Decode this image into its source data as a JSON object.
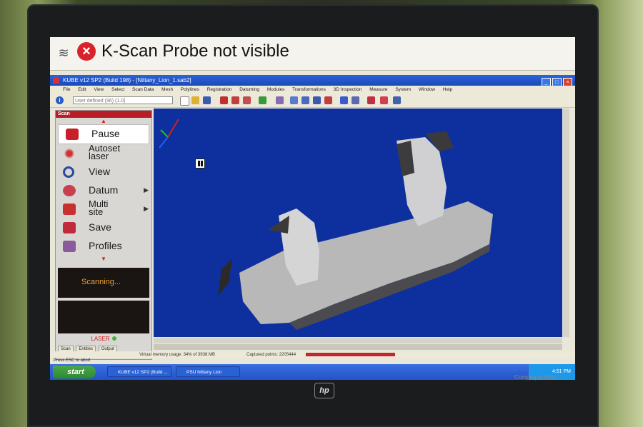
{
  "status_bar": {
    "message": "K-Scan Probe not visible"
  },
  "window": {
    "title": "KUBE v12 SP2 (Build 198) - [Nittany_Lion_1.sab2]",
    "menu": [
      "File",
      "Edit",
      "View",
      "Select",
      "Scan Data",
      "Mesh",
      "Polylines",
      "Registration",
      "Datuming",
      "Modules",
      "Transformations",
      "3D Inspection",
      "Measure",
      "System",
      "Window",
      "Help"
    ],
    "coord_system": "User defined (96) (1.0)"
  },
  "scan_panel": {
    "header": "Scan",
    "items": [
      {
        "label": "Pause",
        "icon": "pause-icon",
        "submenu": false
      },
      {
        "label": "Autoset laser",
        "icon": "laser-icon",
        "submenu": false
      },
      {
        "label": "View",
        "icon": "magnifier-icon",
        "submenu": false
      },
      {
        "label": "Datum",
        "icon": "datum-icon",
        "submenu": true
      },
      {
        "label": "Multi site",
        "icon": "multisite-icon",
        "submenu": true
      },
      {
        "label": "Save",
        "icon": "floppy-icon",
        "submenu": false
      },
      {
        "label": "Profiles",
        "icon": "profiles-icon",
        "submenu": false
      }
    ],
    "status_text": "Scanning...",
    "laser_label": "LASER",
    "tabs": [
      "Scan",
      "Entities",
      "Output"
    ]
  },
  "footer": {
    "virtual_memory": "Virtual memory usage: 34% of 3938 MB",
    "captured_points": "Captured points: 2205444",
    "capture_progress": 1.0,
    "esc_hint": "Press ESC to abort"
  },
  "taskbar": {
    "start_label": "start",
    "tasks": [
      "KUBE v12 SP2 (Build ...",
      "PSU Nittany Lion"
    ],
    "clock": "4:51 PM"
  },
  "hardware": {
    "brand": "hp",
    "model": "Compaq nc8430"
  },
  "colors": {
    "viewport_bg": "#0e2f9e",
    "accent_red": "#b81e28",
    "scanning_text": "#e8a23a"
  }
}
